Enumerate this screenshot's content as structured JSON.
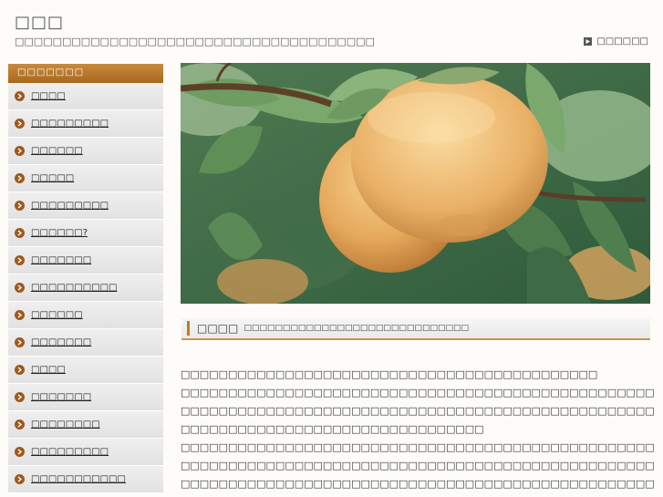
{
  "header": {
    "title": "□□□",
    "description": "□□□□□□□□□□□□□□□□□□□□□□□□□□□□□□□□□□□□□□",
    "link_label": "□□□□□□"
  },
  "sidebar": {
    "heading": "□□□□□□□",
    "items": [
      {
        "label": "□□□□"
      },
      {
        "label": "□□□□□□□□□"
      },
      {
        "label": "□□□□□□"
      },
      {
        "label": "□□□□□"
      },
      {
        "label": "□□□□□□□□□"
      },
      {
        "label": "□□□□□□?"
      },
      {
        "label": "□□□□□□□"
      },
      {
        "label": "□□□□□□□□□□"
      },
      {
        "label": "□□□□□□"
      },
      {
        "label": "□□□□□□□"
      },
      {
        "label": "□□□□"
      },
      {
        "label": "□□□□□□□"
      },
      {
        "label": "□□□□□□□□"
      },
      {
        "label": "□□□□□□□□□"
      },
      {
        "label": "□□□□□□□□□□□"
      }
    ]
  },
  "main": {
    "section_title": "□□□□",
    "section_subtitle": "□□□□□□□□□□□□□□□□□□□□□□□□□□□□□",
    "paragraphs": [
      "□□□□□□□□□□□□□□□□□□□□□□□□□□□□□□□□□□□□□□□□□□□□",
      "□□□□□□□□□□□□□□□□□□□□□□□□□□□□□□□□□□□□□□□□□□□□□□□□□□□□□□□□□□□□□□□□□□□□□□□□□",
      "□□□□□□□□□□□□□□□□□□□□□□□□□□□□□□□□□□□□□□□□□□□□□□□□□□□□□□□□□□□□□□□□□□□□□□□□□□□",
      "□□□□□□□□□□□□□□□□□□□□□□□□□□□□□□□□",
      "□□□□□□□□□□□□□□□□□□□□□□□□□□□□□□□□□□□□□□□□□□□□□□□□□□□□□□□□□",
      "□□□□□□□□□□□□□□□□□□□□□□□□□□□□□□□□□□□□□□□□□□□□□□□□□□□□□□□□□□",
      "□□□□□□□□□□□□□□□□□□□□□□□□□□□□□□□□□□□□□□□□□□□□□□□□□□□□□□□□"
    ]
  },
  "colors": {
    "accent": "#b87228",
    "bullet": "#a0581c"
  },
  "icons": {
    "link": "play-arrow-icon",
    "bullet": "chevron-right-icon"
  }
}
